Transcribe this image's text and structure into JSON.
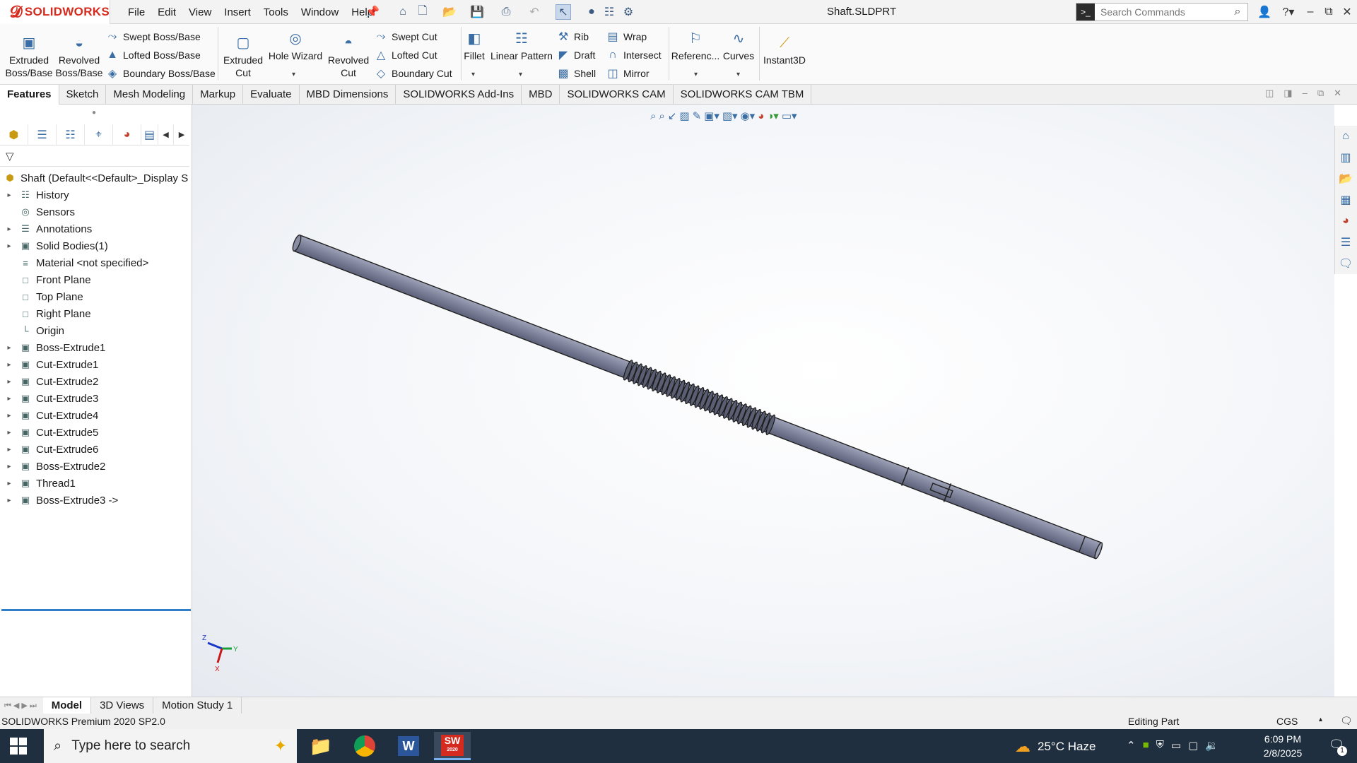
{
  "app": {
    "brand": "SOLIDWORKS",
    "doc_title": "Shaft.SLDPRT"
  },
  "menu": [
    "File",
    "Edit",
    "View",
    "Insert",
    "Tools",
    "Window",
    "Help"
  ],
  "search": {
    "placeholder": "Search Commands"
  },
  "ribbon": {
    "extruded_boss": "Extruded\nBoss/Base",
    "revolved_boss": "Revolved\nBoss/Base",
    "swept_boss": "Swept Boss/Base",
    "lofted_boss": "Lofted Boss/Base",
    "boundary_boss": "Boundary Boss/Base",
    "extruded_cut": "Extruded\nCut",
    "hole_wizard": "Hole Wizard",
    "revolved_cut": "Revolved\nCut",
    "swept_cut": "Swept Cut",
    "lofted_cut": "Lofted Cut",
    "boundary_cut": "Boundary Cut",
    "fillet": "Fillet",
    "linear_pattern": "Linear Pattern",
    "rib": "Rib",
    "draft": "Draft",
    "shell": "Shell",
    "wrap": "Wrap",
    "intersect": "Intersect",
    "mirror": "Mirror",
    "reference": "Referenc...",
    "curves": "Curves",
    "instant3d": "Instant3D"
  },
  "tabs": [
    "Features",
    "Sketch",
    "Mesh Modeling",
    "Markup",
    "Evaluate",
    "MBD Dimensions",
    "SOLIDWORKS Add-Ins",
    "MBD",
    "SOLIDWORKS CAM",
    "SOLIDWORKS CAM TBM"
  ],
  "tree": {
    "root": "Shaft  (Default<<Default>_Display S",
    "items": [
      {
        "label": "History",
        "expand": true
      },
      {
        "label": "Sensors",
        "expand": false
      },
      {
        "label": "Annotations",
        "expand": true
      },
      {
        "label": "Solid Bodies(1)",
        "expand": true
      },
      {
        "label": "Material <not specified>",
        "expand": false
      },
      {
        "label": "Front Plane",
        "expand": false
      },
      {
        "label": "Top Plane",
        "expand": false
      },
      {
        "label": "Right Plane",
        "expand": false
      },
      {
        "label": "Origin",
        "expand": false
      },
      {
        "label": "Boss-Extrude1",
        "expand": true
      },
      {
        "label": "Cut-Extrude1",
        "expand": true
      },
      {
        "label": "Cut-Extrude2",
        "expand": true
      },
      {
        "label": "Cut-Extrude3",
        "expand": true
      },
      {
        "label": "Cut-Extrude4",
        "expand": true
      },
      {
        "label": "Cut-Extrude5",
        "expand": true
      },
      {
        "label": "Cut-Extrude6",
        "expand": true
      },
      {
        "label": "Boss-Extrude2",
        "expand": true
      },
      {
        "label": "Thread1",
        "expand": true
      },
      {
        "label": "Boss-Extrude3 ->",
        "expand": true
      }
    ]
  },
  "model_tabs": [
    "Model",
    "3D Views",
    "Motion Study 1"
  ],
  "status": {
    "version": "SOLIDWORKS Premium 2020 SP2.0",
    "mode": "Editing Part",
    "units": "CGS"
  },
  "axes": {
    "x": "X",
    "y": "Y",
    "z": "Z"
  },
  "taskbar": {
    "search_placeholder": "Type here to search",
    "weather": "25°C  Haze",
    "time": "6:09 PM",
    "date": "2/8/2025",
    "notif_count": "1",
    "sw_badge": "SW",
    "sw_year": "2020"
  }
}
